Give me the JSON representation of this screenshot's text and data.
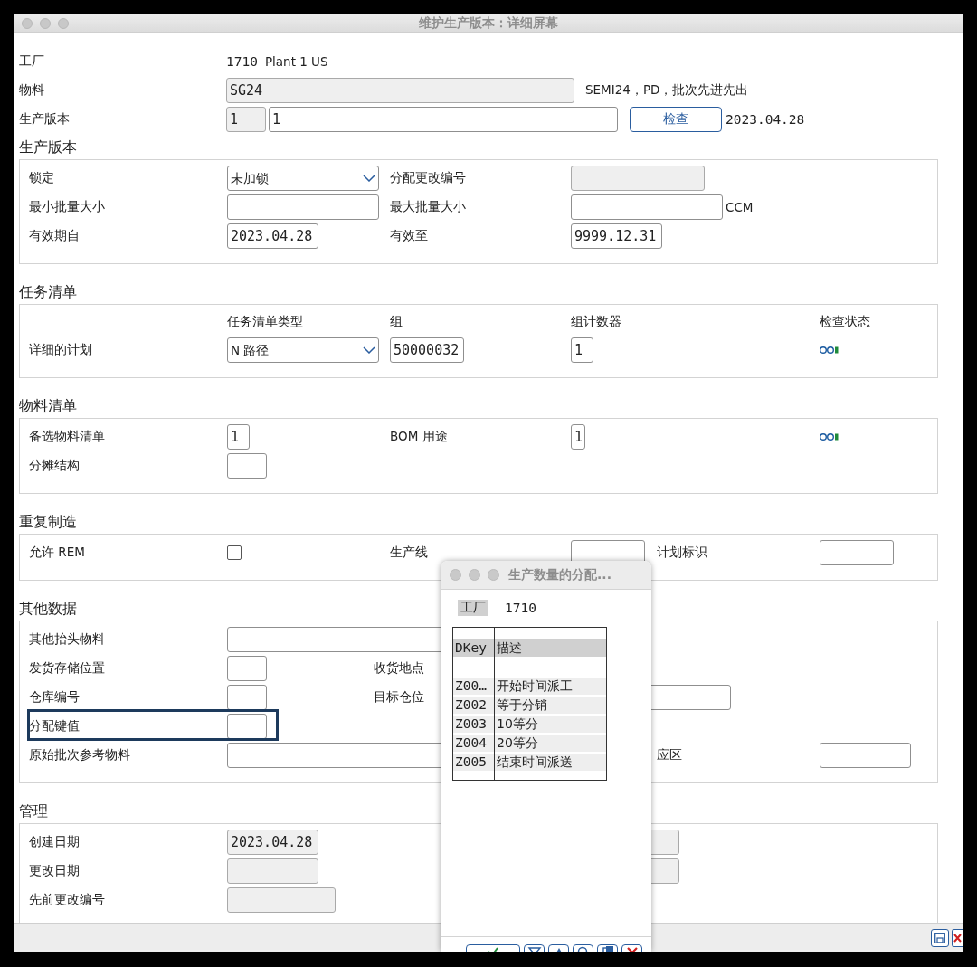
{
  "window": {
    "title": "维护生产版本：详细屏幕"
  },
  "header": {
    "plant": {
      "label": "工厂",
      "code": "1710",
      "name": "Plant 1 US"
    },
    "material": {
      "label": "物料",
      "field": {
        "value": "SG24",
        "readonly": true
      },
      "description": "SEMI24，PD，批次先进先出"
    },
    "version": {
      "label": "生产版本",
      "number": {
        "value": "1",
        "readonly": true
      },
      "text": {
        "value": "1",
        "readonly": false
      },
      "check_button": "检查",
      "date": "2023.04.28"
    }
  },
  "production_version": {
    "title": "生产版本",
    "lock": {
      "label": "锁定",
      "value": "未加锁"
    },
    "change_number": {
      "label": "分配更改编号",
      "readonly": true
    },
    "min_lot": {
      "label": "最小批量大小",
      "readonly": false
    },
    "max_lot": {
      "label": "最大批量大小",
      "readonly": false,
      "unit": "CCM"
    },
    "valid_from": {
      "label": "有效期自",
      "value": "2023.04.28",
      "readonly": false
    },
    "valid_to": {
      "label": "有效至",
      "value": "9999.12.31",
      "readonly": false
    }
  },
  "task_list": {
    "title": "任务清单",
    "columns": [
      "任务清单类型",
      "组",
      "组计数器",
      "检查状态"
    ],
    "row": {
      "label": "详细的计划",
      "type": "N  路径",
      "group": "50000032",
      "counter": "1"
    }
  },
  "bom": {
    "title": "物料清单",
    "alternative": {
      "label": "备选物料清单",
      "value": "1"
    },
    "usage": {
      "label": "BOM 用途",
      "value": "1"
    },
    "apportionment": {
      "label": "分摊结构"
    }
  },
  "repetitive": {
    "title": "重复制造",
    "allow_rem": {
      "label": "允许 REM",
      "checked": false
    },
    "production_line": {
      "label": "生产线"
    },
    "planning_id": {
      "label": "计划标识"
    }
  },
  "other_data": {
    "title": "其他数据",
    "header_material": {
      "label": "其他抬头物料"
    },
    "issue_location": {
      "label": "发货存储位置"
    },
    "receiving_point": {
      "label": "收货地点"
    },
    "warehouse": {
      "label": "仓库编号"
    },
    "destination_bin": {
      "label": "目标仓位"
    },
    "distribution_key": {
      "label": "分配键值",
      "highlighted": true
    },
    "original_batch": {
      "label": "原始批次参考物料"
    },
    "supply_area": {
      "label": "应区"
    }
  },
  "admin": {
    "title": "管理",
    "created": {
      "label": "创建日期",
      "value": "2023.04.28",
      "readonly": true
    },
    "changed": {
      "label": "更改日期",
      "readonly": true
    },
    "previous_change": {
      "label": "先前更改编号",
      "readonly": true
    }
  },
  "popup": {
    "title": "生产数量的分配...",
    "plant_label": "工厂",
    "plant": "1710",
    "columns": [
      "DKey",
      "描述"
    ],
    "rows": [
      {
        "key": "Z00…",
        "description": "开始时间派工"
      },
      {
        "key": "Z002",
        "description": "等于分销"
      },
      {
        "key": "Z003",
        "description": "10等分"
      },
      {
        "key": "Z004",
        "description": "20等分"
      },
      {
        "key": "Z005",
        "description": "结束时间派送"
      }
    ]
  }
}
